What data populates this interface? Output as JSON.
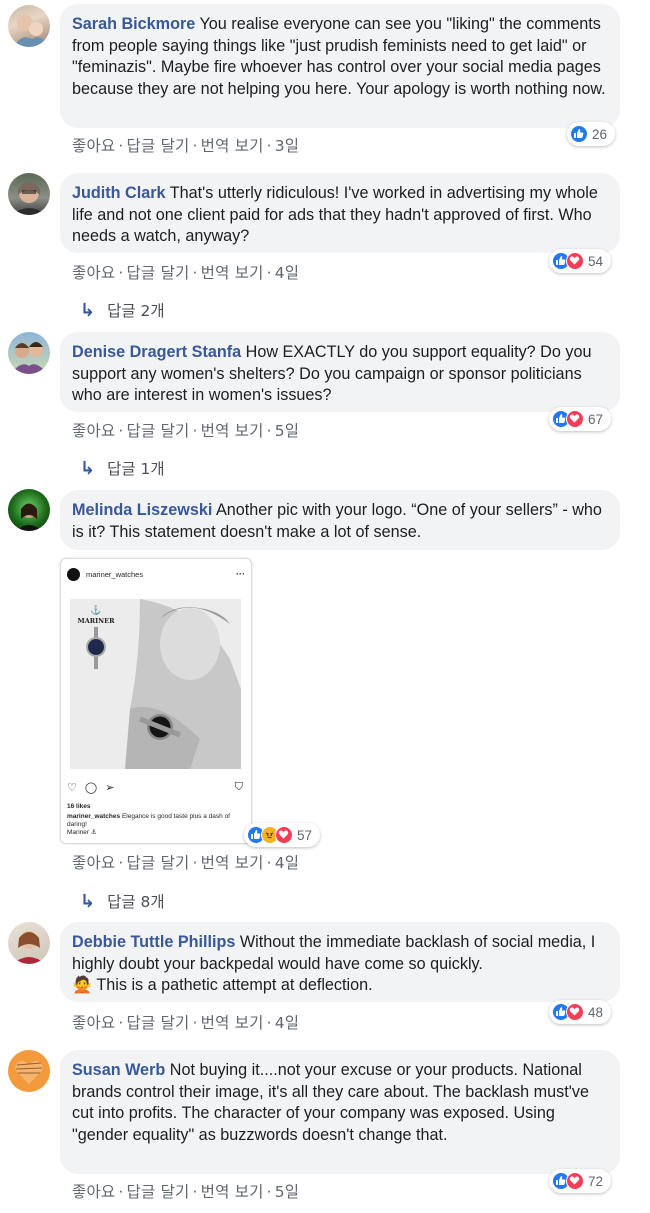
{
  "ui": {
    "like": "좋아요",
    "reply": "답글 달기",
    "translate": "번역 보기",
    "separator": "·"
  },
  "colors": {
    "author": "#385898",
    "bubble": "#f2f3f5",
    "meta": "#606770",
    "like": "#2078f4",
    "love": "#f33e58",
    "angry": "#f7b125"
  },
  "comments": [
    {
      "author": "Sarah Bickmore",
      "text": "You realise everyone can see you \"liking\" the comments from people saying things like \"just prudish feminists need to get laid\" or \"feminazis\". Maybe fire whoever has control over your social media pages because they are not helping you here. Your apology is worth nothing now.",
      "time": "3일",
      "reactions": [
        "like"
      ],
      "count": "26"
    },
    {
      "author": "Judith Clark",
      "text": "That's utterly ridiculous! I've worked in advertising my whole life and not one client paid for ads that they hadn't approved of first. Who needs a watch, anyway?",
      "time": "4일",
      "reactions": [
        "like",
        "love"
      ],
      "count": "54",
      "replies": "답글 2개"
    },
    {
      "author": "Denise Dragert Stanfa",
      "text": "How EXACTLY do you support equality? Do you support any women's shelters? Do you campaign or sponsor politicians who are interest in women's issues?",
      "time": "5일",
      "reactions": [
        "like",
        "love"
      ],
      "count": "67",
      "replies": "답글 1개"
    },
    {
      "author": "Melinda Liszewski",
      "text": "Another pic with your logo. “One of your sellers” - who is it? This statement doesn't make a lot of sense.",
      "time": "4일",
      "reactions": [
        "like",
        "angry",
        "love"
      ],
      "count": "57",
      "replies": "답글 8개",
      "attachment": {
        "account": "mariner_watches",
        "brand": "MARINER",
        "likes": "16 likes",
        "caption_user": "mariner_watches",
        "caption": "Elegance is good taste plus a dash of daring!",
        "signature": "Mariner ⚓"
      }
    },
    {
      "author": "Debbie Tuttle Phillips",
      "text": "Without the immediate backlash of social media, I highly doubt your backpedal would have come so quickly.",
      "emoji": "🙅",
      "text2": "This is a pathetic attempt at deflection.",
      "time": "4일",
      "reactions": [
        "like",
        "love"
      ],
      "count": "48"
    },
    {
      "author": "Susan Werb",
      "text": "Not buying it....not your excuse or your products. National brands control their image, it's all they care about. The backlash must've cut into profits. The character of your company was exposed. Using \"gender equality\" as buzzwords doesn't change that.",
      "time": "5일",
      "reactions": [
        "like",
        "love"
      ],
      "count": "72"
    }
  ]
}
